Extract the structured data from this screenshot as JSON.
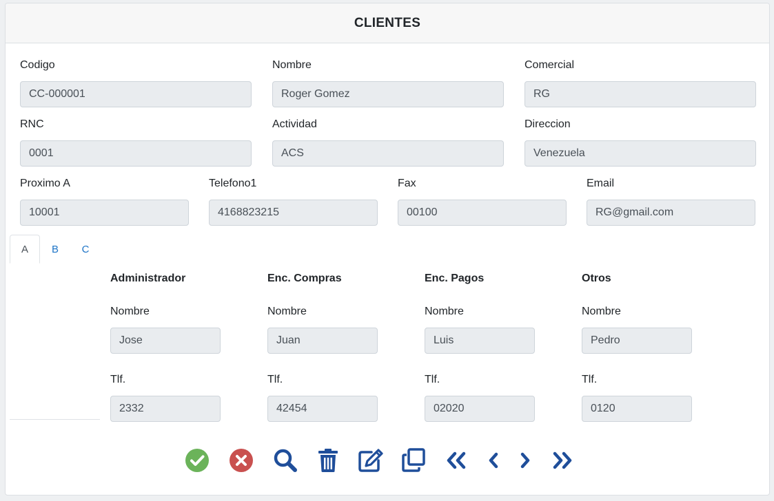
{
  "header": {
    "title": "CLIENTES"
  },
  "fields": {
    "codigo": {
      "label": "Codigo",
      "value": "CC-000001"
    },
    "nombre": {
      "label": "Nombre",
      "value": "Roger Gomez"
    },
    "comercial": {
      "label": "Comercial",
      "value": "RG"
    },
    "rnc": {
      "label": "RNC",
      "value": "0001"
    },
    "actividad": {
      "label": "Actividad",
      "value": "ACS"
    },
    "direccion": {
      "label": "Direccion",
      "value": "Venezuela"
    },
    "proximo": {
      "label": "Proximo A",
      "value": "10001"
    },
    "telefono1": {
      "label": "Telefono1",
      "value": "4168823215"
    },
    "fax": {
      "label": "Fax",
      "value": "00100"
    },
    "email": {
      "label": "Email",
      "value": "RG@gmail.com"
    }
  },
  "tabs": [
    {
      "label": "A",
      "active": true
    },
    {
      "label": "B",
      "active": false
    },
    {
      "label": "C",
      "active": false
    }
  ],
  "contacts": [
    {
      "title": "Administrador",
      "name_label": "Nombre",
      "name": "Jose",
      "phone_label": "Tlf.",
      "phone": "2332"
    },
    {
      "title": "Enc. Compras",
      "name_label": "Nombre",
      "name": "Juan",
      "phone_label": "Tlf.",
      "phone": "42454"
    },
    {
      "title": "Enc. Pagos",
      "name_label": "Nombre",
      "name": "Luis",
      "phone_label": "Tlf.",
      "phone": "02020"
    },
    {
      "title": "Otros",
      "name_label": "Nombre",
      "name": "Pedro",
      "phone_label": "Tlf.",
      "phone": "0120"
    }
  ],
  "toolbar": {
    "buttons": [
      "check-circle-icon",
      "times-circle-icon",
      "search-icon",
      "trash-icon",
      "edit-icon",
      "clone-icon",
      "angle-double-left-icon",
      "angle-left-icon",
      "angle-right-icon",
      "angle-double-right-icon"
    ]
  },
  "colors": {
    "accent": "#1f4e9a",
    "confirm": "#6bb35a",
    "cancel": "#c9504f",
    "tab_link": "#1d74c7",
    "input_bg": "#e9ecef"
  }
}
